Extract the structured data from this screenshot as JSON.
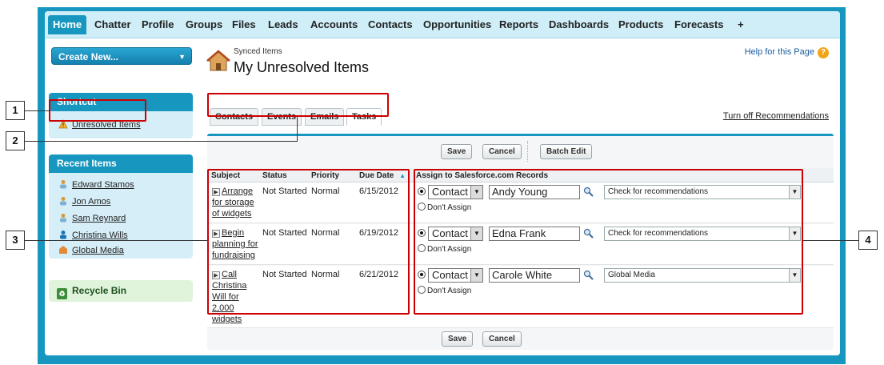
{
  "tabs": [
    "Home",
    "Chatter",
    "Profile",
    "Groups",
    "Files",
    "Leads",
    "Accounts",
    "Contacts",
    "Opportunities",
    "Reports",
    "Dashboards",
    "Products",
    "Forecasts",
    "+"
  ],
  "sidebar": {
    "create_new": "Create New...",
    "shortcut_title": "Shortcut",
    "shortcut_link": "Unresolved Items",
    "recent_title": "Recent Items",
    "recent_items": [
      "Edward Stamos",
      "Jon Amos",
      "Sam Reynard",
      "Christina Wills",
      "Global Media"
    ],
    "recycle_bin": "Recycle Bin"
  },
  "header": {
    "breadcrumb": "Synced Items",
    "title": "My Unresolved Items",
    "help": "Help for this Page"
  },
  "subtabs": [
    "Contacts",
    "Events",
    "Emails",
    "Tasks"
  ],
  "turn_off": "Turn off Recommendations",
  "buttons": {
    "save": "Save",
    "cancel": "Cancel",
    "batch_edit": "Batch Edit"
  },
  "table": {
    "columns": [
      "Subject",
      "Status",
      "Priority",
      "Due Date",
      "Assign to Salesforce.com Records"
    ],
    "rows": [
      {
        "subject_lines": [
          "Arrange",
          "for storage",
          "of widgets"
        ],
        "status": "Not Started",
        "priority": "Normal",
        "due": "6/15/2012",
        "type": "Contact",
        "record": "Andy Young",
        "rec": "Check for recommendations",
        "dont_assign": "Don't Assign"
      },
      {
        "subject_lines": [
          "Begin",
          "planning for",
          "fundraising"
        ],
        "status": "Not Started",
        "priority": "Normal",
        "due": "6/19/2012",
        "type": "Contact",
        "record": "Edna Frank",
        "rec": "Check for recommendations",
        "dont_assign": "Don't Assign"
      },
      {
        "subject_lines": [
          "Call",
          "Christina",
          "Will for",
          "2,000",
          "widgets"
        ],
        "status": "Not Started",
        "priority": "Normal",
        "due": "6/21/2012",
        "type": "Contact",
        "record": "Carole White",
        "rec": "Global Media",
        "dont_assign": "Don't Assign"
      }
    ]
  },
  "callouts": [
    "1",
    "2",
    "3",
    "4"
  ],
  "colors": {
    "accent": "#1797c0",
    "callout": "#cc0000"
  }
}
